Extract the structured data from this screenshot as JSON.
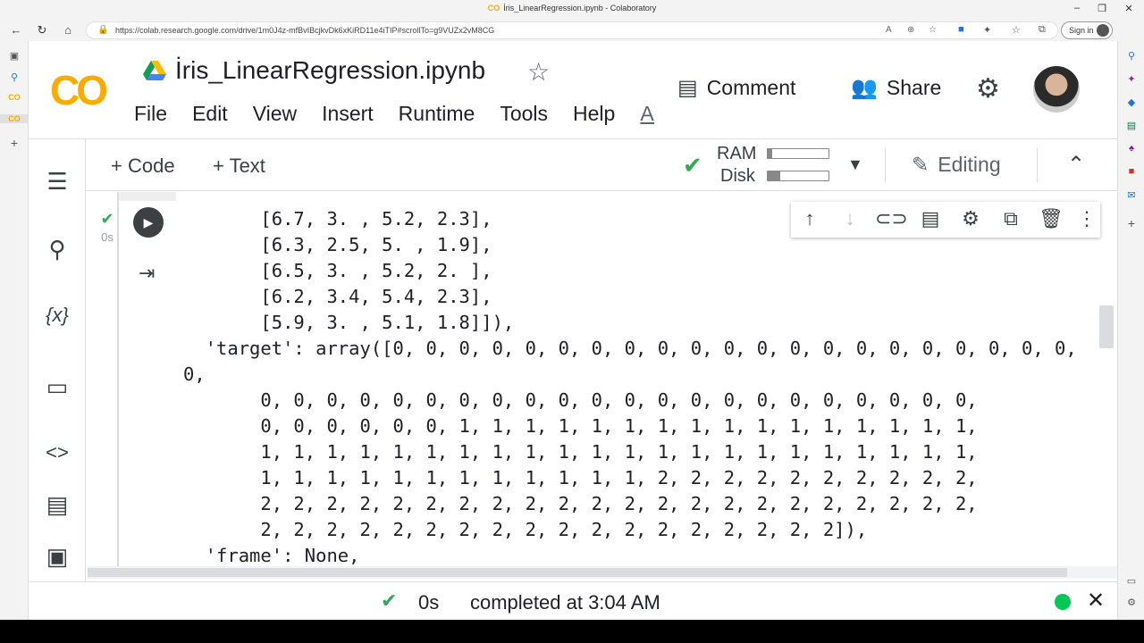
{
  "browser": {
    "window_title": "İris_LinearRegression.ipynb - Colaboratory",
    "tab_logo": "CO",
    "url": "https://colab.research.google.com/drive/1m0J4z-mfBvIBcjkvDk6xKiRD11e4iTIP#scrollTo=g9VUZx2vM8CG",
    "signin_label": "Sign in"
  },
  "header": {
    "logo": "CO",
    "notebook_title": "İris_LinearRegression.ipynb",
    "menu": [
      "File",
      "Edit",
      "View",
      "Insert",
      "Runtime",
      "Tools",
      "Help",
      "All c"
    ],
    "comment_label": "Comment",
    "share_label": "Share"
  },
  "toolbar": {
    "add_code_label": "+ Code",
    "add_text_label": "+ Text",
    "ram_label": "RAM",
    "disk_label": "Disk",
    "ram_usage": 0.08,
    "disk_usage": 0.2,
    "editing_label": "Editing"
  },
  "cell": {
    "exec_time": "0s",
    "output_lines": [
      "       [6.7, 3. , 5.2, 2.3],",
      "       [6.3, 2.5, 5. , 1.9],",
      "       [6.5, 3. , 5.2, 2. ],",
      "       [6.2, 3.4, 5.4, 2.3],",
      "       [5.9, 3. , 5.1, 1.8]]),",
      "  'target': array([0, 0, 0, 0, 0, 0, 0, 0, 0, 0, 0, 0, 0, 0, 0, 0, 0, 0, 0, 0, 0,",
      "0,",
      "       0, 0, 0, 0, 0, 0, 0, 0, 0, 0, 0, 0, 0, 0, 0, 0, 0, 0, 0, 0, 0, 0,",
      "       0, 0, 0, 0, 0, 0, 1, 1, 1, 1, 1, 1, 1, 1, 1, 1, 1, 1, 1, 1, 1, 1,",
      "       1, 1, 1, 1, 1, 1, 1, 1, 1, 1, 1, 1, 1, 1, 1, 1, 1, 1, 1, 1, 1, 1,",
      "       1, 1, 1, 1, 1, 1, 1, 1, 1, 1, 1, 1, 2, 2, 2, 2, 2, 2, 2, 2, 2, 2,",
      "       2, 2, 2, 2, 2, 2, 2, 2, 2, 2, 2, 2, 2, 2, 2, 2, 2, 2, 2, 2, 2, 2,",
      "       2, 2, 2, 2, 2, 2, 2, 2, 2, 2, 2, 2, 2, 2, 2, 2, 2, 2]),",
      "  'frame': None,"
    ]
  },
  "status": {
    "time": "0s",
    "message": "completed at 3:04 AM"
  },
  "colors": {
    "accent_green": "#34a853",
    "logo_yellow": "#f9ab00",
    "logo_orange": "#e8710a"
  }
}
